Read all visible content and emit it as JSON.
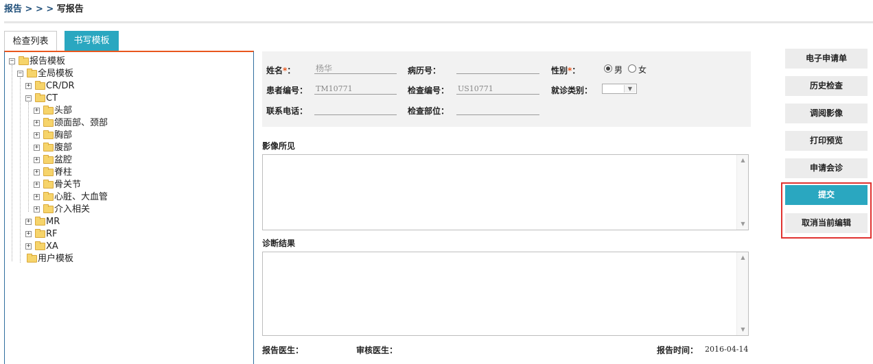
{
  "breadcrumb": {
    "parent": "报告",
    "sep": " > > > ",
    "current": "写报告"
  },
  "tabs": {
    "list": "检查列表",
    "template": "书写模板"
  },
  "tree": {
    "root": "报告模板",
    "global": "全局模板",
    "crdr": "CR/DR",
    "ct": "CT",
    "ct_children": [
      "头部",
      "颌面部、颈部",
      "胸部",
      "腹部",
      "盆腔",
      "脊柱",
      "骨关节",
      "心脏、大血管",
      "介入相关"
    ],
    "mr": "MR",
    "rf": "RF",
    "xa": "XA",
    "user": "用户模板"
  },
  "form": {
    "name_label": "姓名",
    "name_value": "杨华",
    "record_label": "病历号：",
    "gender_label": "性别",
    "gender_options": [
      "男",
      "女"
    ],
    "gender_selected": "男",
    "patient_no_label": "患者编号：",
    "patient_no_value": "TM10771",
    "exam_no_label": "检查编号：",
    "exam_no_value": "US10771",
    "visit_type_label": "就诊类别：",
    "phone_label": "联系电话：",
    "exam_part_label": "检查部位：",
    "required_mark": "*",
    "colon": "："
  },
  "sections": {
    "findings": "影像所见",
    "diagnosis": "诊断结果"
  },
  "footer": {
    "doctor_label": "报告医生：",
    "reviewer_label": "审核医生：",
    "time_label": "报告时间：",
    "time_value": "2016-04-14"
  },
  "buttons": {
    "e_request": "电子申请单",
    "history": "历史检查",
    "view_image": "调阅影像",
    "print_preview": "打印预览",
    "consult": "申请会诊",
    "submit": "提交",
    "cancel_edit": "取消当前编辑"
  },
  "colors": {
    "accent": "#2aa7c0",
    "tab_border": "#e8561d",
    "highlight": "#e0312e",
    "breadcrumb": "#1e4e79"
  }
}
